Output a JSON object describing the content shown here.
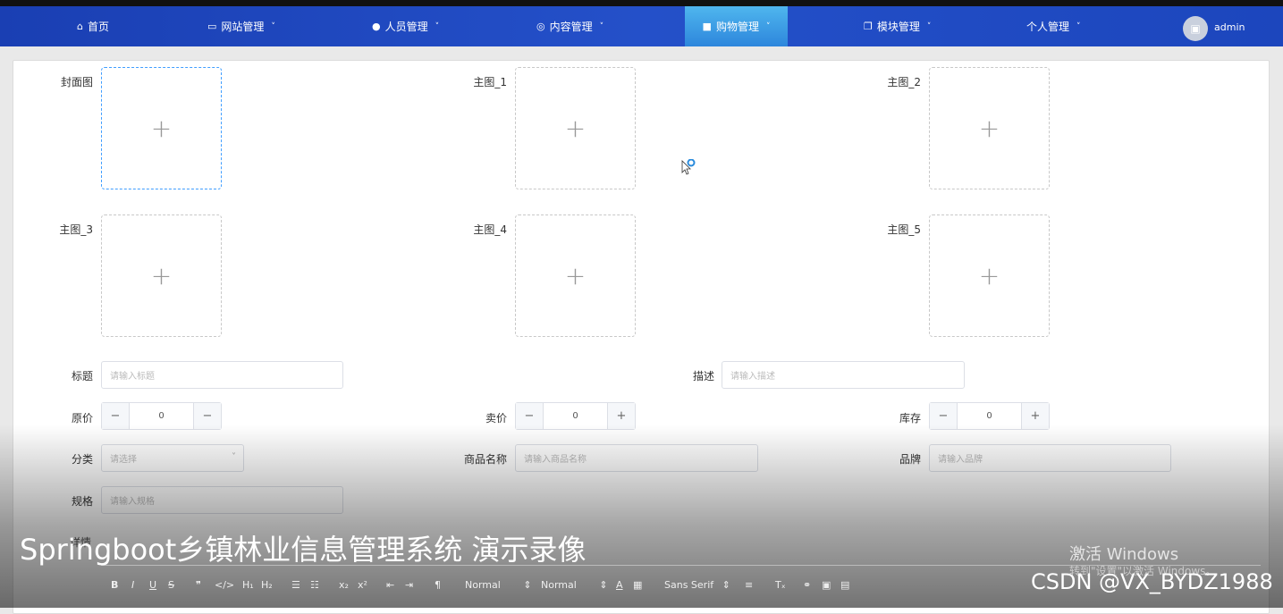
{
  "nav": {
    "items": [
      {
        "label": "首页",
        "icon": "home-icon"
      },
      {
        "label": "网站管理",
        "icon": "monitor-icon"
      },
      {
        "label": "人员管理",
        "icon": "user-icon"
      },
      {
        "label": "内容管理",
        "icon": "chat-icon"
      },
      {
        "label": "购物管理",
        "icon": "bag-icon"
      },
      {
        "label": "模块管理",
        "icon": "copy-icon"
      },
      {
        "label": "个人管理",
        "icon": ""
      }
    ],
    "user": "admin"
  },
  "form": {
    "uploads": [
      {
        "label": "封面图"
      },
      {
        "label": "主图_1"
      },
      {
        "label": "主图_2"
      },
      {
        "label": "主图_3"
      },
      {
        "label": "主图_4"
      },
      {
        "label": "主图_5"
      }
    ],
    "title_label": "标题",
    "title_placeholder": "请输入标题",
    "desc_label": "描述",
    "desc_placeholder": "请输入描述",
    "orig_price_label": "原价",
    "orig_price_value": "0",
    "sale_price_label": "卖价",
    "sale_price_value": "0",
    "stock_label": "库存",
    "stock_value": "0",
    "category_label": "分类",
    "category_placeholder": "请选择",
    "product_name_label": "商品名称",
    "product_name_placeholder": "请输入商品名称",
    "brand_label": "品牌",
    "brand_placeholder": "请输入品牌",
    "spec_label": "规格",
    "spec_placeholder": "请输入规格",
    "detail_label": "详情"
  },
  "editor": {
    "font_size": "Normal",
    "heading": "Normal",
    "font_family": "Sans Serif"
  },
  "overlay": {
    "caption": "Springboot乡镇林业信息管理系统 演示录像",
    "watermark": "CSDN @VX_BYDZ1988",
    "windows_title": "激活 Windows",
    "windows_sub": "转到\"设置\"以激活 Windows。"
  }
}
